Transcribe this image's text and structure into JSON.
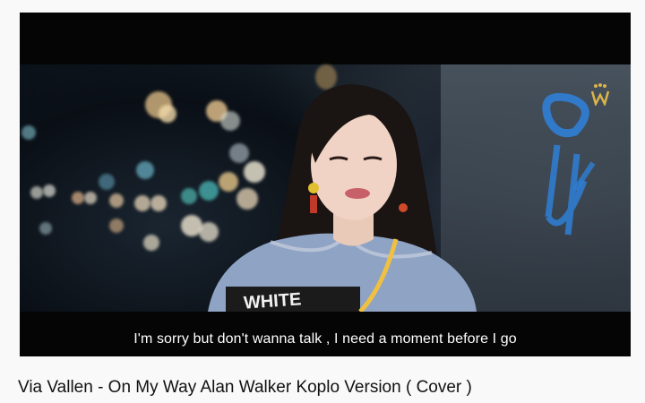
{
  "video": {
    "subtitle": "I'm sorry but don't wanna talk , I need a moment before I go",
    "title": "Via Vallen - On My Way Alan Walker Koplo Version ( Cover )",
    "watermark_icon": "channel-logo-icon",
    "shirt_text": "WHITE"
  },
  "colors": {
    "page_background": "#f9f9f9",
    "player_background": "#050505",
    "subtitle_text": "#ffffff",
    "title_text": "#111111",
    "graffiti": "#2f7fd6",
    "watermark": "#d9b44a"
  }
}
